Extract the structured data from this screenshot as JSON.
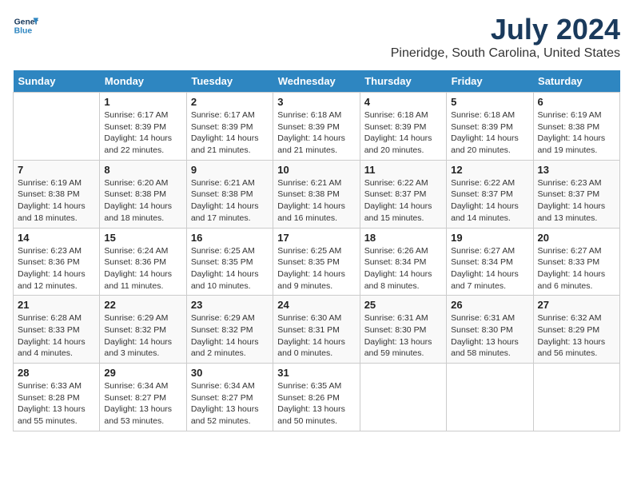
{
  "logo": {
    "line1": "General",
    "line2": "Blue"
  },
  "title": "July 2024",
  "subtitle": "Pineridge, South Carolina, United States",
  "days_of_week": [
    "Sunday",
    "Monday",
    "Tuesday",
    "Wednesday",
    "Thursday",
    "Friday",
    "Saturday"
  ],
  "weeks": [
    [
      {
        "day": "",
        "info": ""
      },
      {
        "day": "1",
        "info": "Sunrise: 6:17 AM\nSunset: 8:39 PM\nDaylight: 14 hours\nand 22 minutes."
      },
      {
        "day": "2",
        "info": "Sunrise: 6:17 AM\nSunset: 8:39 PM\nDaylight: 14 hours\nand 21 minutes."
      },
      {
        "day": "3",
        "info": "Sunrise: 6:18 AM\nSunset: 8:39 PM\nDaylight: 14 hours\nand 21 minutes."
      },
      {
        "day": "4",
        "info": "Sunrise: 6:18 AM\nSunset: 8:39 PM\nDaylight: 14 hours\nand 20 minutes."
      },
      {
        "day": "5",
        "info": "Sunrise: 6:18 AM\nSunset: 8:39 PM\nDaylight: 14 hours\nand 20 minutes."
      },
      {
        "day": "6",
        "info": "Sunrise: 6:19 AM\nSunset: 8:38 PM\nDaylight: 14 hours\nand 19 minutes."
      }
    ],
    [
      {
        "day": "7",
        "info": "Sunrise: 6:19 AM\nSunset: 8:38 PM\nDaylight: 14 hours\nand 18 minutes."
      },
      {
        "day": "8",
        "info": "Sunrise: 6:20 AM\nSunset: 8:38 PM\nDaylight: 14 hours\nand 18 minutes."
      },
      {
        "day": "9",
        "info": "Sunrise: 6:21 AM\nSunset: 8:38 PM\nDaylight: 14 hours\nand 17 minutes."
      },
      {
        "day": "10",
        "info": "Sunrise: 6:21 AM\nSunset: 8:38 PM\nDaylight: 14 hours\nand 16 minutes."
      },
      {
        "day": "11",
        "info": "Sunrise: 6:22 AM\nSunset: 8:37 PM\nDaylight: 14 hours\nand 15 minutes."
      },
      {
        "day": "12",
        "info": "Sunrise: 6:22 AM\nSunset: 8:37 PM\nDaylight: 14 hours\nand 14 minutes."
      },
      {
        "day": "13",
        "info": "Sunrise: 6:23 AM\nSunset: 8:37 PM\nDaylight: 14 hours\nand 13 minutes."
      }
    ],
    [
      {
        "day": "14",
        "info": "Sunrise: 6:23 AM\nSunset: 8:36 PM\nDaylight: 14 hours\nand 12 minutes."
      },
      {
        "day": "15",
        "info": "Sunrise: 6:24 AM\nSunset: 8:36 PM\nDaylight: 14 hours\nand 11 minutes."
      },
      {
        "day": "16",
        "info": "Sunrise: 6:25 AM\nSunset: 8:35 PM\nDaylight: 14 hours\nand 10 minutes."
      },
      {
        "day": "17",
        "info": "Sunrise: 6:25 AM\nSunset: 8:35 PM\nDaylight: 14 hours\nand 9 minutes."
      },
      {
        "day": "18",
        "info": "Sunrise: 6:26 AM\nSunset: 8:34 PM\nDaylight: 14 hours\nand 8 minutes."
      },
      {
        "day": "19",
        "info": "Sunrise: 6:27 AM\nSunset: 8:34 PM\nDaylight: 14 hours\nand 7 minutes."
      },
      {
        "day": "20",
        "info": "Sunrise: 6:27 AM\nSunset: 8:33 PM\nDaylight: 14 hours\nand 6 minutes."
      }
    ],
    [
      {
        "day": "21",
        "info": "Sunrise: 6:28 AM\nSunset: 8:33 PM\nDaylight: 14 hours\nand 4 minutes."
      },
      {
        "day": "22",
        "info": "Sunrise: 6:29 AM\nSunset: 8:32 PM\nDaylight: 14 hours\nand 3 minutes."
      },
      {
        "day": "23",
        "info": "Sunrise: 6:29 AM\nSunset: 8:32 PM\nDaylight: 14 hours\nand 2 minutes."
      },
      {
        "day": "24",
        "info": "Sunrise: 6:30 AM\nSunset: 8:31 PM\nDaylight: 14 hours\nand 0 minutes."
      },
      {
        "day": "25",
        "info": "Sunrise: 6:31 AM\nSunset: 8:30 PM\nDaylight: 13 hours\nand 59 minutes."
      },
      {
        "day": "26",
        "info": "Sunrise: 6:31 AM\nSunset: 8:30 PM\nDaylight: 13 hours\nand 58 minutes."
      },
      {
        "day": "27",
        "info": "Sunrise: 6:32 AM\nSunset: 8:29 PM\nDaylight: 13 hours\nand 56 minutes."
      }
    ],
    [
      {
        "day": "28",
        "info": "Sunrise: 6:33 AM\nSunset: 8:28 PM\nDaylight: 13 hours\nand 55 minutes."
      },
      {
        "day": "29",
        "info": "Sunrise: 6:34 AM\nSunset: 8:27 PM\nDaylight: 13 hours\nand 53 minutes."
      },
      {
        "day": "30",
        "info": "Sunrise: 6:34 AM\nSunset: 8:27 PM\nDaylight: 13 hours\nand 52 minutes."
      },
      {
        "day": "31",
        "info": "Sunrise: 6:35 AM\nSunset: 8:26 PM\nDaylight: 13 hours\nand 50 minutes."
      },
      {
        "day": "",
        "info": ""
      },
      {
        "day": "",
        "info": ""
      },
      {
        "day": "",
        "info": ""
      }
    ]
  ]
}
